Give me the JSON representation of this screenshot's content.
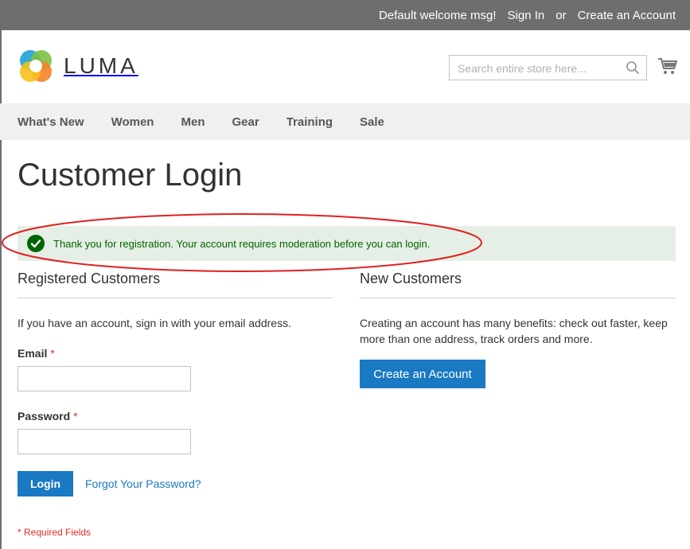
{
  "top_bar": {
    "welcome": "Default welcome msg!",
    "sign_in": "Sign In",
    "or": "or",
    "create_account": "Create an Account"
  },
  "header": {
    "logo_text": "LUMA",
    "search_placeholder": "Search entire store here...",
    "search_value": ""
  },
  "nav": {
    "items": [
      "What's New",
      "Women",
      "Men",
      "Gear",
      "Training",
      "Sale"
    ]
  },
  "page": {
    "title": "Customer Login"
  },
  "message": {
    "text": "Thank you for registration. Your account requires moderation before you can login.",
    "type": "success"
  },
  "registered": {
    "title": "Registered Customers",
    "intro": "If you have an account, sign in with your email address.",
    "email_label": "Email",
    "password_label": "Password",
    "required_mark": "*",
    "email_value": "",
    "password_value": "",
    "login_button": "Login",
    "forgot_link": "Forgot Your Password?",
    "required_note": "* Required Fields"
  },
  "new_customers": {
    "title": "New Customers",
    "intro": "Creating an account has many benefits: check out faster, keep more than one address, track orders and more.",
    "create_button": "Create an Account"
  },
  "colors": {
    "top_bar_bg": "#6e6e6e",
    "nav_bg": "#f0f0f0",
    "primary_button": "#1979c3",
    "success_bg": "#e5efe5",
    "success_text": "#006400",
    "required": "#e02b27",
    "annotation": "#e02020"
  }
}
